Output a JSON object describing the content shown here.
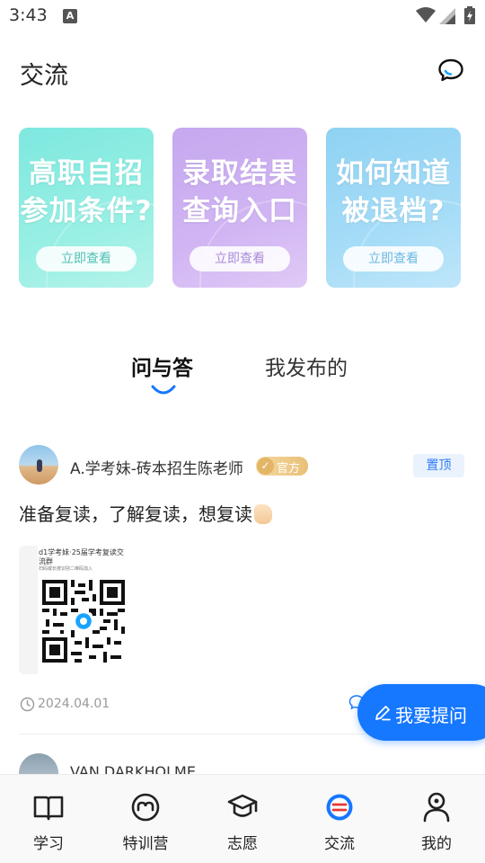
{
  "status_bar": {
    "time": "3:43",
    "notification_icon": "A"
  },
  "header": {
    "title": "交流",
    "message_icon": "chat-bubble-icon"
  },
  "banners": [
    {
      "line1": "高职自招",
      "line2": "参加条件?",
      "button": "立即查看",
      "color": "#7ee8df"
    },
    {
      "line1": "录取结果",
      "line2": "查询入口",
      "button": "立即查看",
      "color": "#c5a8ef"
    },
    {
      "line1": "如何知道",
      "line2": "被退档?",
      "button": "立即查看",
      "color": "#8fd2f3"
    }
  ],
  "tabs": {
    "qa": "问与答",
    "mine": "我发布的",
    "active": "qa"
  },
  "post": {
    "author": "A.学考妹-砖本招生陈老师",
    "official_badge": "官方",
    "pin_label": "置顶",
    "text": "准备复读，了解复读，想复读",
    "qr_title": "d1学考妹·25届学考复读交流群",
    "qr_subtitle": "扫码或长按识别二维码加入",
    "date": "2024.04.01"
  },
  "next_post": {
    "author": "VAN DARKHOLME"
  },
  "fab": {
    "label": "我要提问"
  },
  "bottom_nav": [
    {
      "label": "学习",
      "icon": "book-icon"
    },
    {
      "label": "特训营",
      "icon": "smile-icon"
    },
    {
      "label": "志愿",
      "icon": "graduation-cap-icon"
    },
    {
      "label": "交流",
      "icon": "chat-icon",
      "active": true
    },
    {
      "label": "我的",
      "icon": "user-icon"
    }
  ],
  "colors": {
    "accent": "#1677ff",
    "pin_bg": "#eaf2fd",
    "badge_gold": "#e8c078"
  }
}
